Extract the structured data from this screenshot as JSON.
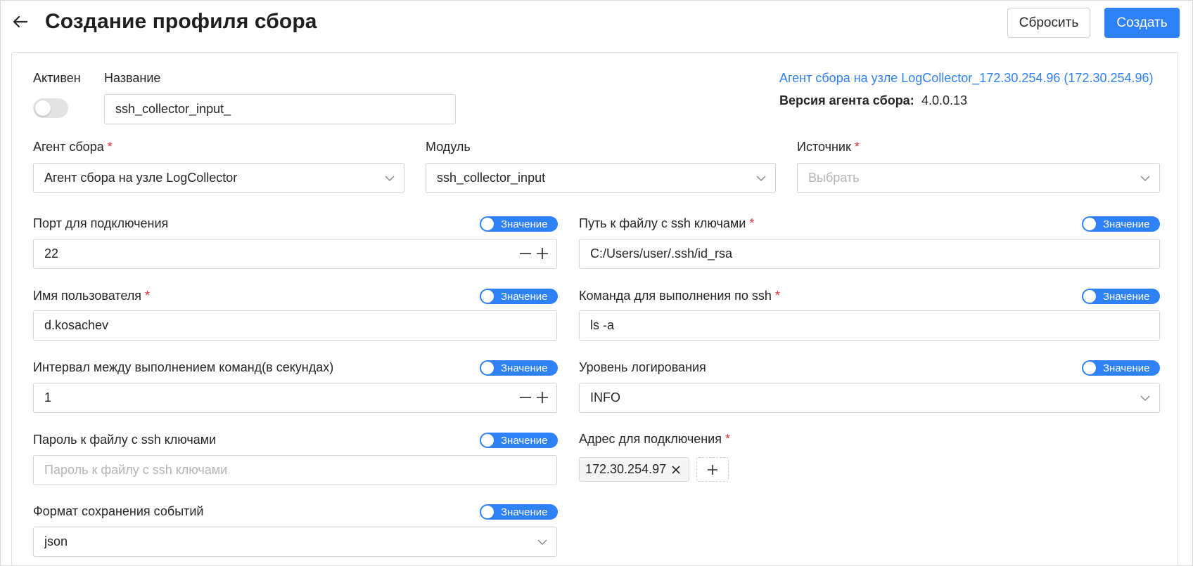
{
  "header": {
    "title": "Создание профиля сбора",
    "reset_label": "Сбросить",
    "create_label": "Создать"
  },
  "agent_info": {
    "link_text": "Агент сбора на узле LogCollector_172.30.254.96 (172.30.254.96)",
    "version_label": "Версия агента сбора:",
    "version_value": "4.0.0.13"
  },
  "active": {
    "label": "Активен",
    "enabled": false
  },
  "name": {
    "label": "Название",
    "value": "ssh_collector_input_"
  },
  "agent": {
    "label": "Агент сбора",
    "value": "Агент сбора на узле LogCollector"
  },
  "module": {
    "label": "Модуль",
    "value": "ssh_collector_input"
  },
  "source": {
    "label": "Источник",
    "placeholder": "Выбрать"
  },
  "toggle_label": "Значение",
  "port": {
    "label": "Порт для подключения",
    "value": "22"
  },
  "ssh_key_path": {
    "label": "Путь к файлу с ssh ключами",
    "value": "C:/Users/user/.ssh/id_rsa"
  },
  "username": {
    "label": "Имя пользователя",
    "value": "d.kosachev"
  },
  "ssh_command": {
    "label": "Команда для выполнения по ssh",
    "value": "ls -a"
  },
  "interval": {
    "label": "Интервал между выполнением команд(в секундах)",
    "value": "1"
  },
  "log_level": {
    "label": "Уровень логирования",
    "value": "INFO"
  },
  "key_password": {
    "label": "Пароль к файлу с ssh ключами",
    "placeholder": "Пароль к файлу с ssh ключами"
  },
  "address": {
    "label": "Адрес для подключения",
    "tags": [
      "172.30.254.97"
    ]
  },
  "event_format": {
    "label": "Формат сохранения событий",
    "value": "json"
  },
  "colors": {
    "accent": "#2f81f7",
    "required": "#e5303b",
    "toggle_off": "#e3e3e3"
  }
}
